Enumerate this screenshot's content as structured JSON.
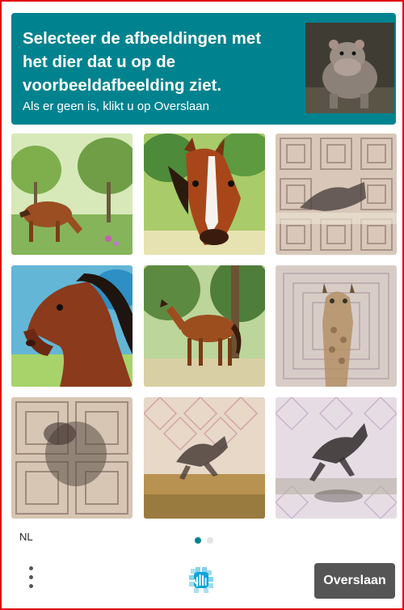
{
  "header": {
    "title": "Selecteer de afbeeldingen met het dier dat u op de voorbeeldafbeelding ziet.",
    "subtitle": "Als er geen is, klikt u op Overslaan",
    "background": "#00838f"
  },
  "grid": {
    "cells": [
      {
        "subject": "horse-grazing-forest"
      },
      {
        "subject": "horse-head-portrait"
      },
      {
        "subject": "shadow-pattern"
      },
      {
        "subject": "horse-head-watercolor"
      },
      {
        "subject": "horse-standing-forest"
      },
      {
        "subject": "giraffe-pattern"
      },
      {
        "subject": "blurred-zebra-pattern"
      },
      {
        "subject": "jumping-horse-pattern"
      },
      {
        "subject": "jumping-horse-blur"
      }
    ]
  },
  "footer": {
    "language": "NL",
    "page_indicator": {
      "current": 1,
      "total": 2
    },
    "skip_label": "Overslaan",
    "logo_icon": "hand-icon",
    "menu_icon": "kebab-menu-icon",
    "accent": "#00838f",
    "button_color": "#555555"
  }
}
